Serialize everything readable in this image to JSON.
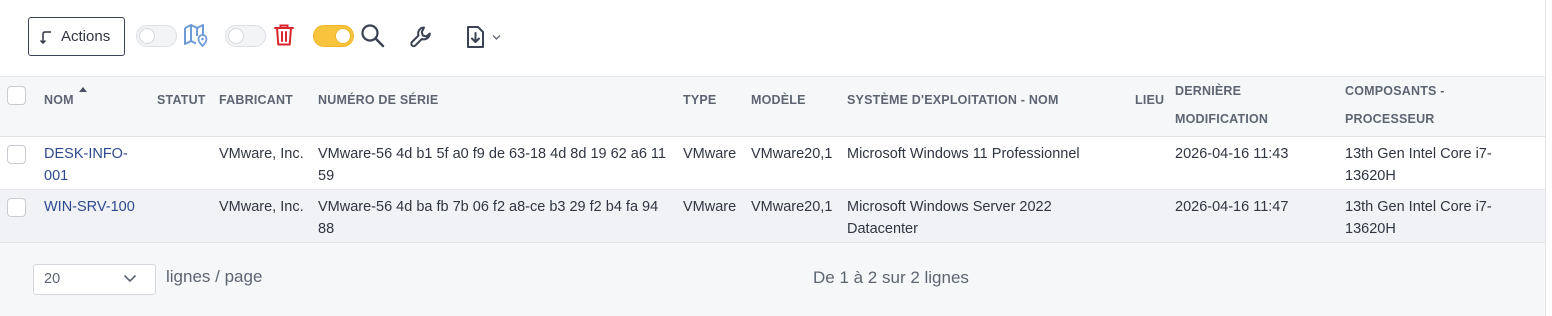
{
  "toolbar": {
    "actions_label": "Actions",
    "toggles": [
      {
        "name": "map",
        "on": false
      },
      {
        "name": "trash",
        "on": false
      },
      {
        "name": "search",
        "on": true
      }
    ],
    "icons": [
      "map-icon",
      "trash-icon",
      "search-icon",
      "wrench-icon",
      "export-icon",
      "chevron-down-icon"
    ],
    "colors": {
      "toggle_on": "#f8c33d",
      "trash": "#d8262c",
      "map": "#6f9ad8"
    }
  },
  "table": {
    "columns": [
      {
        "key": "nom",
        "label": "NOM",
        "sorted": "asc"
      },
      {
        "key": "statut",
        "label": "STATUT"
      },
      {
        "key": "fabricant",
        "label": "FABRICANT"
      },
      {
        "key": "serie",
        "label": "NUMÉRO DE SÉRIE"
      },
      {
        "key": "type",
        "label": "TYPE"
      },
      {
        "key": "modele",
        "label": "MODÈLE"
      },
      {
        "key": "os",
        "label": "SYSTÈME D'EXPLOITATION - NOM"
      },
      {
        "key": "lieu",
        "label": "LIEU"
      },
      {
        "key": "modif",
        "label": "DERNIÈRE MODIFICATION"
      },
      {
        "key": "cpu",
        "label": "COMPOSANTS - PROCESSEUR"
      }
    ],
    "rows": [
      {
        "nom": "DESK-INFO-001",
        "statut": "",
        "fabricant": "VMware, Inc.",
        "serie": "VMware-56 4d b1 5f a0 f9 de 63-18 4d 8d 19 62 a6 11 59",
        "type": "VMware",
        "modele": "VMware20,1",
        "os": "Microsoft Windows 11 Professionnel",
        "lieu": "",
        "modif": "2026-04-16 11:43",
        "cpu": "13th Gen Intel Core i7-13620H"
      },
      {
        "nom": "WIN-SRV-100",
        "statut": "",
        "fabricant": "VMware, Inc.",
        "serie": "VMware-56 4d ba fb 7b 06 f2 a8-ce b3 29 f2 b4 fa 94 88",
        "type": "VMware",
        "modele": "VMware20,1",
        "os": "Microsoft Windows Server 2022 Datacenter",
        "lieu": "",
        "modif": "2026-04-16 11:47",
        "cpu": "13th Gen Intel Core i7-13620H"
      }
    ]
  },
  "footer": {
    "per_page_value": "20",
    "per_page_label": "lignes / page",
    "pagination_text": "De 1 à 2 sur 2 lignes"
  }
}
